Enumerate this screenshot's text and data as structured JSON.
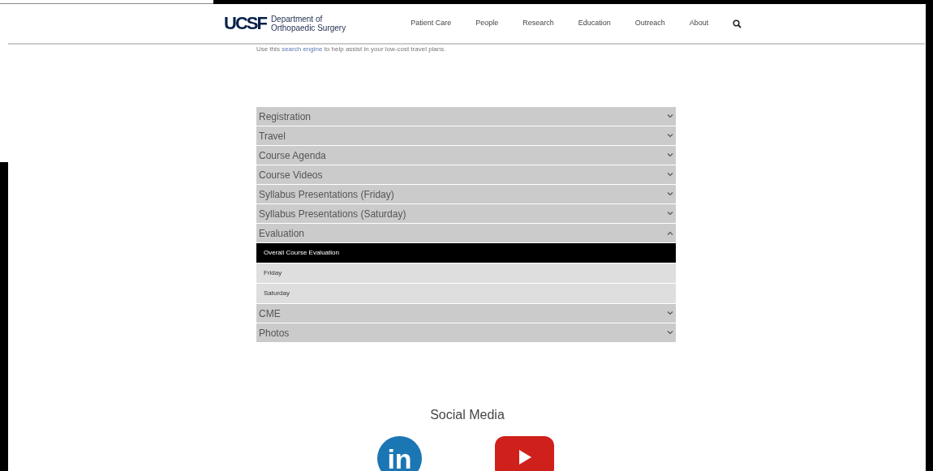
{
  "header": {
    "logo": "UCSF",
    "department": [
      "Department of",
      "Orthopaedic Surgery"
    ],
    "nav": [
      "Patient Care",
      "People",
      "Research",
      "Education",
      "Outreach",
      "About"
    ]
  },
  "intro": {
    "before": "Use this",
    "link": "search engine",
    "after": "to help assist in your low-cost travel plans."
  },
  "accordion": [
    {
      "title": "Registration",
      "expanded": false
    },
    {
      "title": "Travel",
      "expanded": false
    },
    {
      "title": "Course Agenda",
      "expanded": false
    },
    {
      "title": "Course Videos",
      "expanded": false
    },
    {
      "title": "Syllabus Presentations (Friday)",
      "expanded": false
    },
    {
      "title": "Syllabus Presentations (Saturday)",
      "expanded": false
    },
    {
      "title": "Evaluation",
      "expanded": true,
      "children": [
        {
          "label": "Overall Course Evaluation",
          "selected": true
        },
        {
          "label": "Friday",
          "selected": false
        },
        {
          "label": "Saturday",
          "selected": false
        }
      ]
    },
    {
      "title": "CME",
      "expanded": false
    },
    {
      "title": "Photos",
      "expanded": false
    }
  ],
  "social": {
    "title": "Social Media",
    "links": [
      {
        "kind": "linkedin",
        "label": "in"
      },
      {
        "kind": "youtube"
      }
    ]
  }
}
